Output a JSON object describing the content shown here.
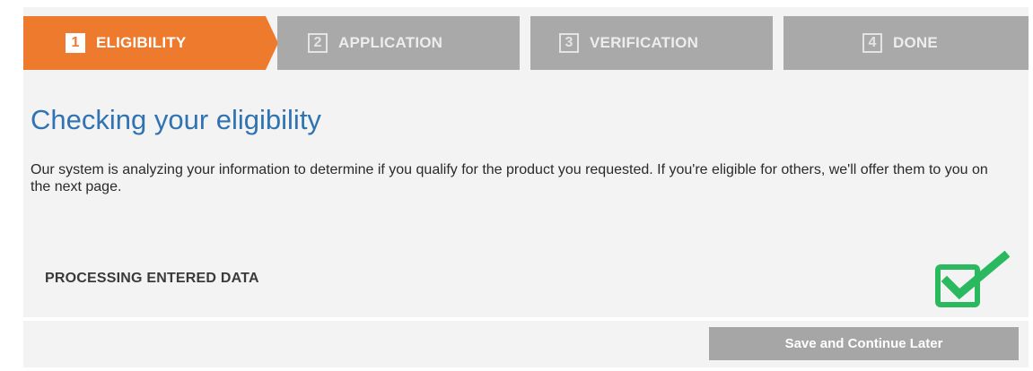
{
  "stepper": {
    "steps": [
      {
        "number": "1",
        "label": "ELIGIBILITY",
        "active": true
      },
      {
        "number": "2",
        "label": "APPLICATION",
        "active": false
      },
      {
        "number": "3",
        "label": "VERIFICATION",
        "active": false
      },
      {
        "number": "4",
        "label": "DONE",
        "active": false
      }
    ],
    "active_color": "#ee7a2e",
    "inactive_color": "#a9a9a9"
  },
  "main": {
    "title": "Checking your eligibility",
    "description": "Our system is analyzing your information to determine if you qualify for the product you requested. If you're eligible for others, we'll offer them to you on the next page.",
    "status_text": "PROCESSING ENTERED DATA",
    "status_icon": "checkbox-checked-icon",
    "status_color": "#2bb95f"
  },
  "footer": {
    "save_label": "Save and Continue Later"
  }
}
